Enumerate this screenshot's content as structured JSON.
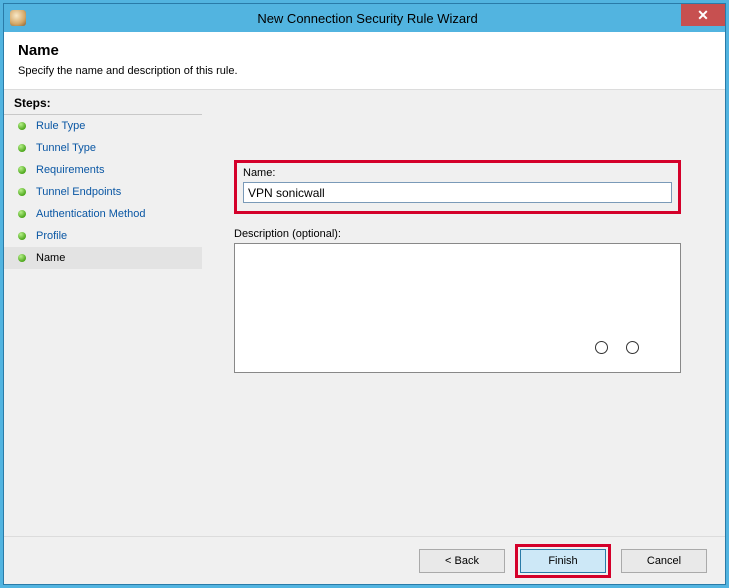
{
  "window": {
    "title": "New Connection Security Rule Wizard",
    "close_glyph": "✕"
  },
  "header": {
    "title": "Name",
    "subtitle": "Specify the name and description of this rule."
  },
  "sidebar": {
    "heading": "Steps:",
    "items": [
      {
        "label": "Rule Type"
      },
      {
        "label": "Tunnel Type"
      },
      {
        "label": "Requirements"
      },
      {
        "label": "Tunnel Endpoints"
      },
      {
        "label": "Authentication Method"
      },
      {
        "label": "Profile"
      },
      {
        "label": "Name"
      }
    ],
    "current_index": 6
  },
  "form": {
    "name_label": "Name:",
    "name_value": "VPN sonicwall",
    "description_label": "Description (optional):",
    "description_value": ""
  },
  "footer": {
    "back": "< Back",
    "finish": "Finish",
    "cancel": "Cancel"
  }
}
